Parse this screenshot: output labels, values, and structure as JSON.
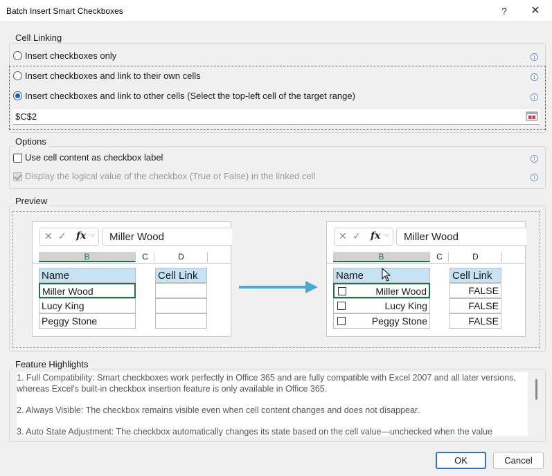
{
  "window": {
    "title": "Batch Insert Smart Checkboxes",
    "help": "?",
    "close": "✕"
  },
  "cell_linking": {
    "legend": "Cell Linking",
    "options": [
      {
        "label": "Insert checkboxes only",
        "checked": false
      },
      {
        "label": "Insert checkboxes and link to their own cells",
        "checked": false
      },
      {
        "label": "Insert checkboxes and link to other cells (Select the top-left cell of the target range)",
        "checked": true
      }
    ],
    "range_value": "$C$2"
  },
  "options": {
    "legend": "Options",
    "use_label": "Use cell content as checkbox label",
    "display_logical": "Display the logical value of the checkbox (True or False) in the linked cell"
  },
  "preview": {
    "legend": "Preview",
    "formula_fx": "fx",
    "formula_value": "Miller Wood",
    "col_b": "B",
    "col_c": "C",
    "col_d": "D",
    "header_name": "Name",
    "header_link": "Cell Link",
    "names": [
      "Miller Wood",
      "Lucy King",
      "Peggy Stone"
    ],
    "after_values": [
      "FALSE",
      "FALSE",
      "FALSE"
    ],
    "arrow_color": "#4aa8d8"
  },
  "features": {
    "legend": "Feature Highlights",
    "items": [
      "1. Full Compatibility: Smart checkboxes work perfectly in Office 365 and are fully compatible with Excel 2007 and all later versions, whereas Excel's built-in checkbox insertion feature is only available in Office 365.",
      "2. Always Visible: The checkbox remains visible even when cell content changes and does not disappear.",
      "3. Auto State Adjustment: The checkbox automatically changes its state based on the cell value—unchecked when the value"
    ]
  },
  "buttons": {
    "ok": "OK",
    "cancel": "Cancel"
  },
  "colors": {
    "accent": "#1a5fb4",
    "excel_green": "#217346",
    "header_blue": "#c5e3f5",
    "dashed_red": "#d33c46"
  }
}
